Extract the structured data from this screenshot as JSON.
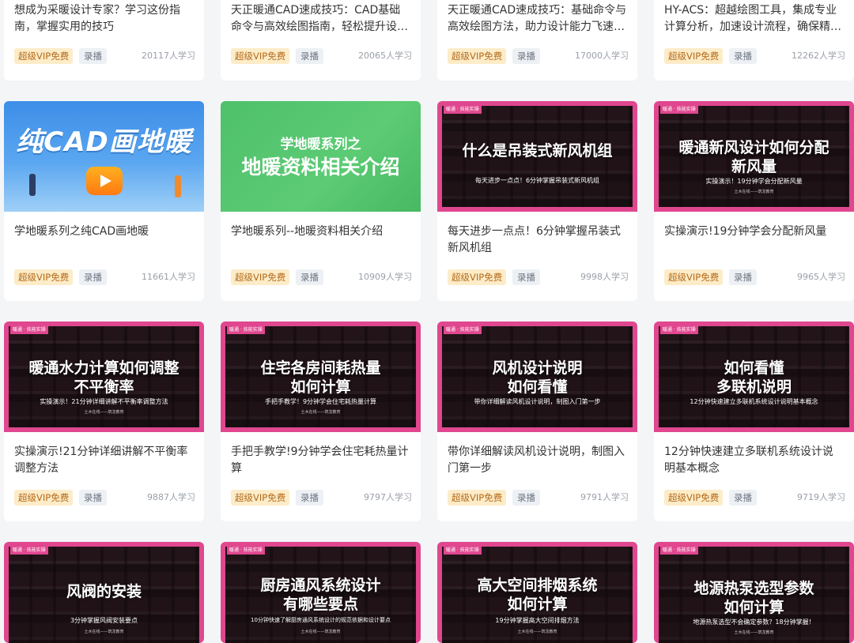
{
  "cards": [
    {
      "title": "想成为采暖设计专家？学习这份指南，掌握实用的技巧",
      "vip": "超级VIP免费",
      "rec": "录播",
      "learn": "20117人学习"
    },
    {
      "title": "天正暖通CAD速成技巧：CAD基础命令与高效绘图指南，轻松提升设计效率",
      "vip": "超级VIP免费",
      "rec": "录播",
      "learn": "20065人学习"
    },
    {
      "title": "天正暖通CAD速成技巧：基础命令与高效绘图方法，助力设计能力飞速提升",
      "vip": "超级VIP免费",
      "rec": "录播",
      "learn": "17000人学习"
    },
    {
      "title": "HY-ACS：超越绘图工具，集成专业计算分析，加速设计流程，确保精准高效",
      "vip": "超级VIP免费",
      "rec": "录播",
      "learn": "12262人学习"
    },
    {
      "title": "学地暖系列之纯CAD画地暖",
      "vip": "超级VIP免费",
      "rec": "录播",
      "learn": "11661人学习",
      "thumb": {
        "text": "纯CAD画地暖"
      }
    },
    {
      "title": "学地暖系列--地暖资料相关介绍",
      "vip": "超级VIP免费",
      "rec": "录播",
      "learn": "10909人学习",
      "thumb": {
        "line1": "学地暖系列之",
        "line2": "地暖资料相关介绍"
      }
    },
    {
      "title": "每天进步一点点！6分钟掌握吊装式新风机组",
      "vip": "超级VIP免费",
      "rec": "录播",
      "learn": "9998人学习",
      "thumb": {
        "tag": "暖通 · 技能实操",
        "line1": "什么是吊装式新风机组",
        "line2": "",
        "sub": "每天进步一点点！6分钟掌握吊装式新风机组",
        "foot": ""
      }
    },
    {
      "title": "实操演示!19分钟学会分配新风量",
      "vip": "超级VIP免费",
      "rec": "录播",
      "learn": "9965人学习",
      "thumb": {
        "tag": "暖通 · 技能实操",
        "line1": "暖通新风设计如何分配",
        "line2": "新风量",
        "sub": "实操演示！19分钟学会分配新风量",
        "foot": "土木在线——筑龙教育"
      }
    },
    {
      "title": "实操演示!21分钟详细讲解不平衡率调整方法",
      "vip": "超级VIP免费",
      "rec": "录播",
      "learn": "9887人学习",
      "thumb": {
        "tag": "暖通 · 技能实操",
        "line1": "暖通水力计算如何调整",
        "line2": "不平衡率",
        "sub": "实操演示！21分钟详细讲解不平衡率调整方法",
        "foot": "土木在线——筑龙教育"
      }
    },
    {
      "title": "手把手教学!9分钟学会住宅耗热量计算",
      "vip": "超级VIP免费",
      "rec": "录播",
      "learn": "9797人学习",
      "thumb": {
        "tag": "暖通 · 技能实操",
        "line1": "住宅各房间耗热量",
        "line2": "如何计算",
        "sub": "手把手教学！9分钟学会住宅耗热量计算",
        "foot": "土木在线——筑龙教育"
      }
    },
    {
      "title": "带你详细解读风机设计说明，制图入门第一步",
      "vip": "超级VIP免费",
      "rec": "录播",
      "learn": "9791人学习",
      "thumb": {
        "tag": "暖通 · 技能实操",
        "line1": "风机设计说明",
        "line2": "如何看懂",
        "sub": "带你详细解读风机设计说明，制图入门第一步",
        "foot": ""
      }
    },
    {
      "title": "12分钟快速建立多联机系统设计说明基本概念",
      "vip": "超级VIP免费",
      "rec": "录播",
      "learn": "9719人学习",
      "thumb": {
        "tag": "暖通 · 技能实操",
        "line1": "如何看懂",
        "line2": "多联机说明",
        "sub": "12分钟快速建立多联机系统设计说明基本概念",
        "foot": ""
      }
    },
    {
      "title": "",
      "thumb": {
        "tag": "暖通 · 技能实操",
        "line1": "风阀的安装",
        "line2": "",
        "sub": "3分钟掌握风阀安装要点",
        "foot": "土木在线——筑龙教育"
      }
    },
    {
      "title": "",
      "thumb": {
        "tag": "暖通 · 技能实操",
        "line1": "厨房通风系统设计",
        "line2": "有哪些要点",
        "sub": "10分钟快速了解厨房通风系统设计的规范依据和设计要点",
        "foot": "土木在线——筑龙教育"
      }
    },
    {
      "title": "",
      "thumb": {
        "tag": "暖通 · 技能实操",
        "line1": "高大空间排烟系统",
        "line2": "如何计算",
        "sub": "19分钟掌握高大空间排烟方法",
        "foot": "土木在线——筑龙教育"
      }
    },
    {
      "title": "",
      "thumb": {
        "tag": "暖通 · 技能实操",
        "line1": "地源热泵选型参数",
        "line2": "如何计算",
        "sub": "地源热泵选型不会确定参数？18分钟掌握！",
        "foot": "土木在线——筑龙教育"
      }
    }
  ],
  "colors": {
    "vip_bg": "#fdecc8",
    "vip_text": "#b46a1a",
    "rec_bg": "#edf0f4",
    "thumb_pink": "#e0478f"
  }
}
